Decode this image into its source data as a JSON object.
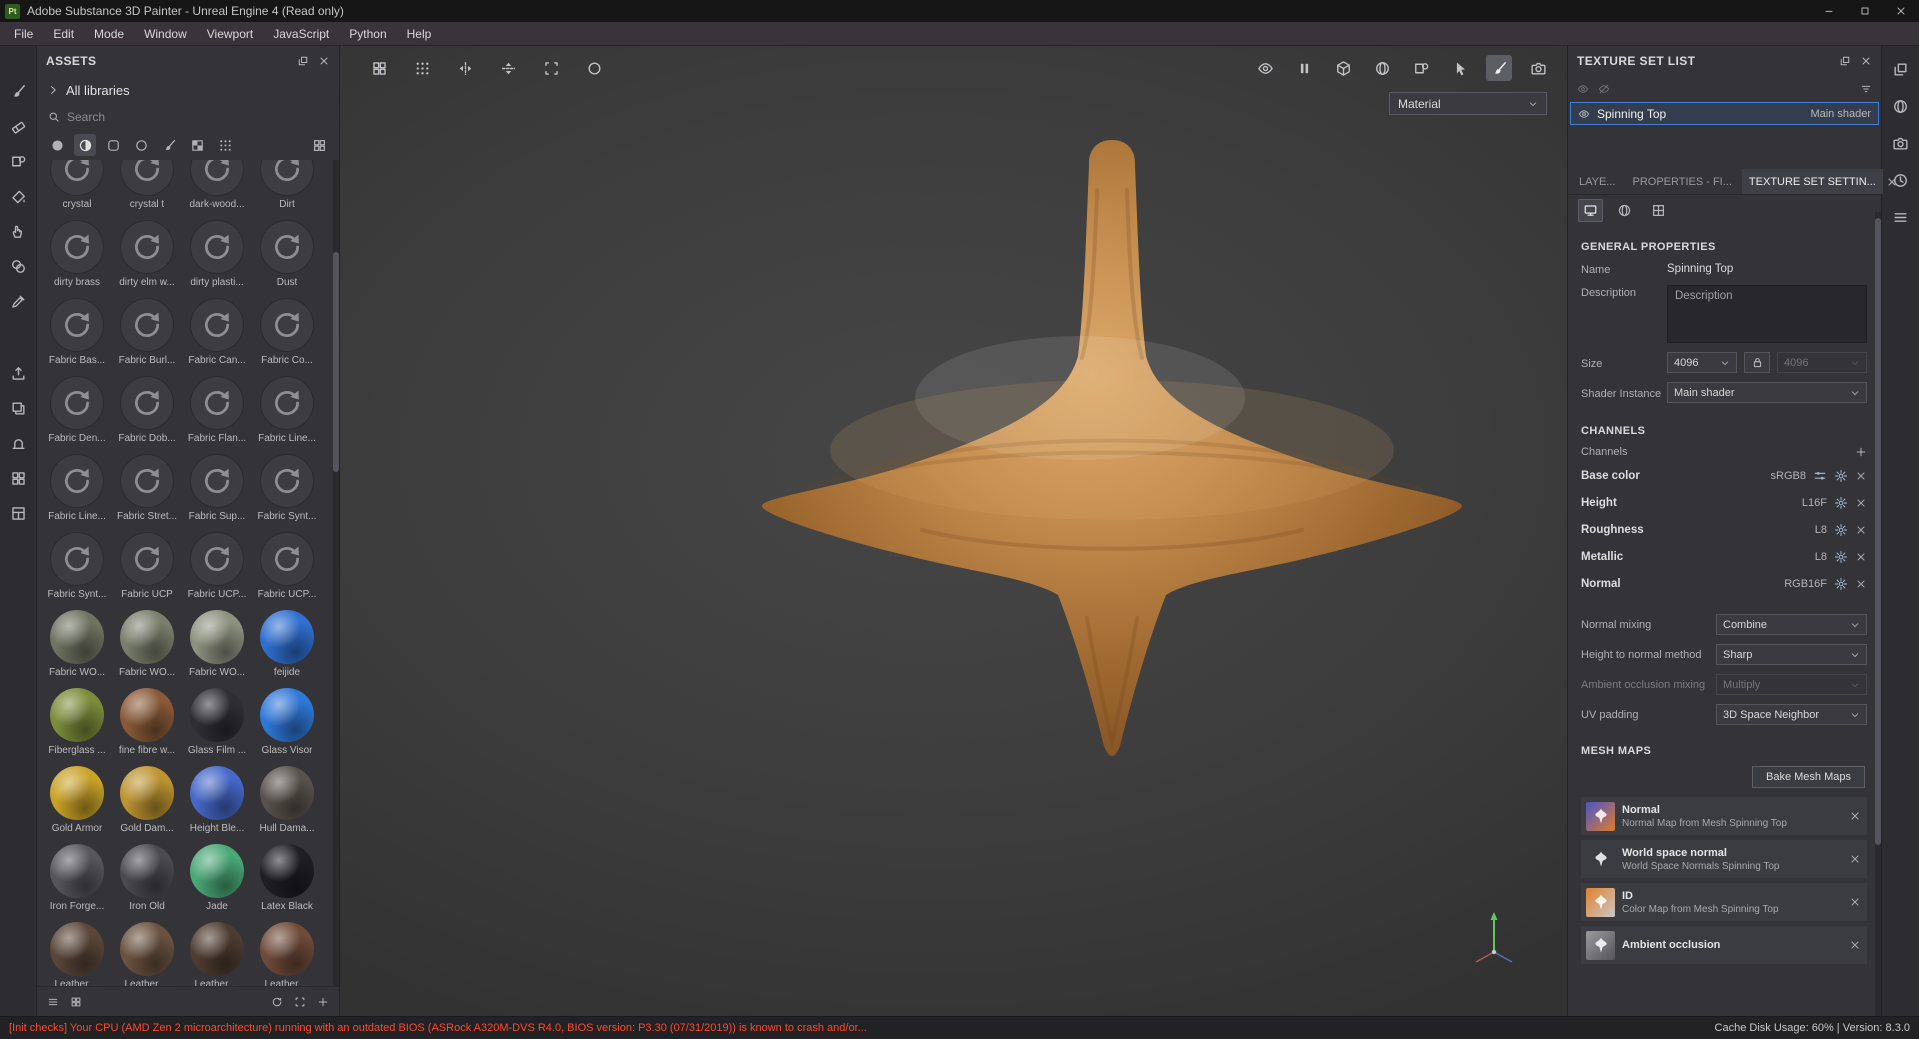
{
  "titlebar": {
    "app_badge": "Pt",
    "title": "Adobe Substance 3D Painter - Unreal Engine 4 (Read only)",
    "window_buttons": [
      {
        "name": "minimize-button",
        "shape": "minimize"
      },
      {
        "name": "maximize-button",
        "shape": "maximize"
      },
      {
        "name": "close-button",
        "shape": "close"
      }
    ]
  },
  "menubar": {
    "items": [
      "File",
      "Edit",
      "Mode",
      "Window",
      "Viewport",
      "JavaScript",
      "Python",
      "Help"
    ]
  },
  "left_toolbar": {
    "tools": [
      {
        "name": "paint-tool-icon",
        "shape": "brush"
      },
      {
        "name": "eraser-tool-icon",
        "shape": "eraser"
      },
      {
        "name": "projection-tool-icon",
        "shape": "projection"
      },
      {
        "name": "polygon-fill-tool-icon",
        "shape": "bucket"
      },
      {
        "name": "smudge-tool-icon",
        "shape": "smudge"
      },
      {
        "name": "clone-tool-icon",
        "shape": "stamp"
      },
      {
        "name": "material-picker-tool-icon",
        "shape": "dropper"
      }
    ],
    "lower": [
      {
        "name": "export-icon",
        "shape": "export"
      },
      {
        "name": "resources-icon",
        "shape": "layers"
      },
      {
        "name": "baking-icon",
        "shape": "bake"
      },
      {
        "name": "texture-sets-icon",
        "shape": "grid4"
      },
      {
        "name": "shelf-icon",
        "shape": "shelf"
      }
    ]
  },
  "assets_panel": {
    "title": "ASSETS",
    "library_label": "All libraries",
    "search_placeholder": "Search",
    "filter_icons": [
      {
        "name": "materials-filter-icon",
        "shape": "sphere-fill",
        "active": false
      },
      {
        "name": "smart-materials-filter-icon",
        "shape": "sphere-half",
        "active": true
      },
      {
        "name": "smart-masks-filter-icon",
        "shape": "round-square",
        "active": false
      },
      {
        "name": "filters-filter-icon",
        "shape": "circle",
        "active": false
      },
      {
        "name": "brushes-filter-icon",
        "shape": "brush",
        "active": false
      },
      {
        "name": "textures-filter-icon",
        "shape": "checker",
        "active": false
      },
      {
        "name": "environments-filter-icon",
        "shape": "dots9",
        "active": false
      }
    ],
    "grid_view_icon": {
      "name": "grid-view-icon",
      "shape": "grid4"
    },
    "items": [
      {
        "label": "crystal",
        "kind": "placeholder"
      },
      {
        "label": "crystal t",
        "kind": "placeholder"
      },
      {
        "label": "dark-wood...",
        "kind": "placeholder"
      },
      {
        "label": "Dirt",
        "kind": "placeholder"
      },
      {
        "label": "dirty brass",
        "kind": "placeholder"
      },
      {
        "label": "dirty elm w...",
        "kind": "placeholder"
      },
      {
        "label": "dirty plasti...",
        "kind": "placeholder"
      },
      {
        "label": "Dust",
        "kind": "placeholder"
      },
      {
        "label": "Fabric Bas...",
        "kind": "placeholder"
      },
      {
        "label": "Fabric Burl...",
        "kind": "placeholder"
      },
      {
        "label": "Fabric Can...",
        "kind": "placeholder"
      },
      {
        "label": "Fabric Co...",
        "kind": "placeholder"
      },
      {
        "label": "Fabric Den...",
        "kind": "placeholder"
      },
      {
        "label": "Fabric Dob...",
        "kind": "placeholder"
      },
      {
        "label": "Fabric Flan...",
        "kind": "placeholder"
      },
      {
        "label": "Fabric Line...",
        "kind": "placeholder"
      },
      {
        "label": "Fabric Line...",
        "kind": "placeholder"
      },
      {
        "label": "Fabric Stret...",
        "kind": "placeholder"
      },
      {
        "label": "Fabric Sup...",
        "kind": "placeholder"
      },
      {
        "label": "Fabric Synt...",
        "kind": "placeholder"
      },
      {
        "label": "Fabric Synt...",
        "kind": "placeholder"
      },
      {
        "label": "Fabric UCP",
        "kind": "placeholder"
      },
      {
        "label": "Fabric UCP...",
        "kind": "placeholder"
      },
      {
        "label": "Fabric UCP...",
        "kind": "placeholder"
      },
      {
        "label": "Fabric WO...",
        "kind": "sphere",
        "color": "#6f7361"
      },
      {
        "label": "Fabric WO...",
        "kind": "sphere",
        "color": "#7b7f6d"
      },
      {
        "label": "Fabric WO...",
        "kind": "sphere",
        "color": "#8d917f"
      },
      {
        "label": "feijide",
        "kind": "sphere",
        "color": "#2f6fd0"
      },
      {
        "label": "Fiberglass ...",
        "kind": "sphere",
        "color": "#7c8c3a"
      },
      {
        "label": "fine fibre w...",
        "kind": "sphere",
        "color": "#8a5a38"
      },
      {
        "label": "Glass Film ...",
        "kind": "sphere",
        "color": "#2e2e34"
      },
      {
        "label": "Glass Visor",
        "kind": "sphere",
        "color": "#2f78d8"
      },
      {
        "label": "Gold Armor",
        "kind": "sphere",
        "color": "#c9a227"
      },
      {
        "label": "Gold Dam...",
        "kind": "sphere",
        "color": "#bd9430"
      },
      {
        "label": "Height Ble...",
        "kind": "sphere",
        "color": "#4668c8"
      },
      {
        "label": "Hull Dama...",
        "kind": "sphere",
        "color": "#58524b"
      },
      {
        "label": "Iron Forge...",
        "kind": "sphere",
        "color": "#56565c"
      },
      {
        "label": "Iron Old",
        "kind": "sphere",
        "color": "#4a4a50"
      },
      {
        "label": "Jade",
        "kind": "sphere",
        "color": "#4aa878"
      },
      {
        "label": "Latex Black",
        "kind": "sphere",
        "color": "#1e1e24"
      },
      {
        "label": "Leather ...",
        "kind": "sphere",
        "color": "#5a4638"
      },
      {
        "label": "Leather ...",
        "kind": "sphere",
        "color": "#6a523f"
      },
      {
        "label": "Leather ...",
        "kind": "sphere",
        "color": "#4e3c30"
      },
      {
        "label": "Leather ...",
        "kind": "sphere",
        "color": "#6e4a38"
      }
    ],
    "footer_icons_left": [
      {
        "name": "small-thumbnails-icon",
        "shape": "list"
      },
      {
        "name": "large-thumbnails-icon",
        "shape": "grid4"
      }
    ],
    "footer_icons_right": [
      {
        "name": "refresh-shelf-icon",
        "shape": "refresh"
      },
      {
        "name": "frame-view-icon",
        "shape": "frame"
      },
      {
        "name": "add-asset-icon",
        "shape": "plus"
      }
    ]
  },
  "viewport": {
    "toolbar_left": [
      {
        "name": "tiles-icon",
        "shape": "grid4"
      },
      {
        "name": "tile-offset-icon",
        "shape": "dots9"
      },
      {
        "name": "symmetry-x-icon",
        "shape": "mirror-x"
      },
      {
        "name": "symmetry-y-icon",
        "shape": "mirror-y"
      },
      {
        "name": "crop-frame-icon",
        "shape": "frame"
      },
      {
        "name": "snap-icon",
        "shape": "circle"
      }
    ],
    "toolbar_right": [
      {
        "name": "perspective-toggle-icon",
        "shape": "eye",
        "active": false
      },
      {
        "name": "pause-engine-icon",
        "shape": "pause",
        "active": false
      },
      {
        "name": "geometry-mode-icon",
        "shape": "cube",
        "active": false
      },
      {
        "name": "material-mode-icon",
        "shape": "sphere",
        "active": false
      },
      {
        "name": "stencil-icon",
        "shape": "projection",
        "active": false
      },
      {
        "name": "cursor-tool-icon",
        "shape": "cursor",
        "active": false
      },
      {
        "name": "paint-mode-icon",
        "shape": "brush",
        "active": true
      },
      {
        "name": "screenshot-icon",
        "shape": "camera",
        "active": false
      }
    ],
    "material_select": {
      "value": "Material"
    }
  },
  "texture_set_list": {
    "title": "TEXTURE SET LIST",
    "set_name": "Spinning Top",
    "shader_label": "Main shader"
  },
  "tabs": {
    "items": [
      {
        "label": "LAYE...",
        "active": false
      },
      {
        "label": "PROPERTIES - FI...",
        "active": false
      },
      {
        "label": "TEXTURE SET SETTIN...",
        "active": true
      }
    ]
  },
  "texture_set_settings": {
    "subicons": [
      {
        "name": "settings-platform-icon",
        "shape": "monitor",
        "active": true
      },
      {
        "name": "settings-shader-icon",
        "shape": "sphere",
        "active": false
      },
      {
        "name": "settings-uv-icon",
        "shape": "uv-grid",
        "active": false
      }
    ],
    "general": {
      "section": "GENERAL PROPERTIES",
      "name_label": "Name",
      "name_value": "Spinning Top",
      "description_label": "Description",
      "description_value": "Description",
      "size_label": "Size",
      "size_value": "4096",
      "size_locked_value": "4096",
      "shader_instance_label": "Shader Instance",
      "shader_instance_value": "Main shader"
    },
    "channels": {
      "section": "CHANNELS",
      "row_label": "Channels",
      "rows": [
        {
          "name": "Base color",
          "format": "sRGB8",
          "extra_icon": true
        },
        {
          "name": "Height",
          "format": "L16F",
          "extra_icon": false
        },
        {
          "name": "Roughness",
          "format": "L8",
          "extra_icon": false
        },
        {
          "name": "Metallic",
          "format": "L8",
          "extra_icon": false
        },
        {
          "name": "Normal",
          "format": "RGB16F",
          "extra_icon": false
        }
      ]
    },
    "mixing": [
      {
        "label": "Normal mixing",
        "value": "Combine",
        "disabled": false
      },
      {
        "label": "Height to normal method",
        "value": "Sharp",
        "disabled": false
      },
      {
        "label": "Ambient occlusion mixing",
        "value": "Multiply",
        "disabled": true
      },
      {
        "label": "UV padding",
        "value": "3D Space Neighbor",
        "disabled": false
      }
    ],
    "mesh_maps": {
      "section": "MESH MAPS",
      "bake_button": "Bake Mesh Maps",
      "items": [
        {
          "title": "Normal",
          "subtitle": "Normal Map from Mesh Spinning Top",
          "thumb_from": "#4a55c8",
          "thumb_to": "#e07b2a"
        },
        {
          "title": "World space normal",
          "subtitle": "World Space Normals Spinning Top",
          "thumb_from": "#35b44a",
          "thumb_to": "#c8press"
        },
        {
          "title": "ID",
          "subtitle": "Color Map from Mesh Spinning Top",
          "thumb_from": "#e0812a",
          "thumb_to": "#c8c8c8"
        },
        {
          "title": "Ambient occlusion",
          "subtitle": "",
          "thumb_from": "#9a9a9a",
          "thumb_to": "#55555a"
        }
      ]
    }
  },
  "right_toolbar": {
    "icons": [
      {
        "name": "dock-toggle-icon",
        "shape": "undock"
      },
      {
        "name": "environment-settings-icon",
        "shape": "sphere"
      },
      {
        "name": "camera-settings-icon",
        "shape": "camera"
      },
      {
        "name": "history-icon",
        "shape": "clock"
      },
      {
        "name": "log-icon",
        "shape": "list"
      }
    ]
  },
  "statusbar": {
    "warning": "[Init checks] Your CPU (AMD Zen 2 microarchitecture) running with an outdated BIOS (ASRock A320M-DVS R4.0, BIOS version: P3.30 (07/31/2019)) is known to crash and/or...",
    "right_text": "Cache Disk Usage:  60% | Version: 8.3.0"
  }
}
